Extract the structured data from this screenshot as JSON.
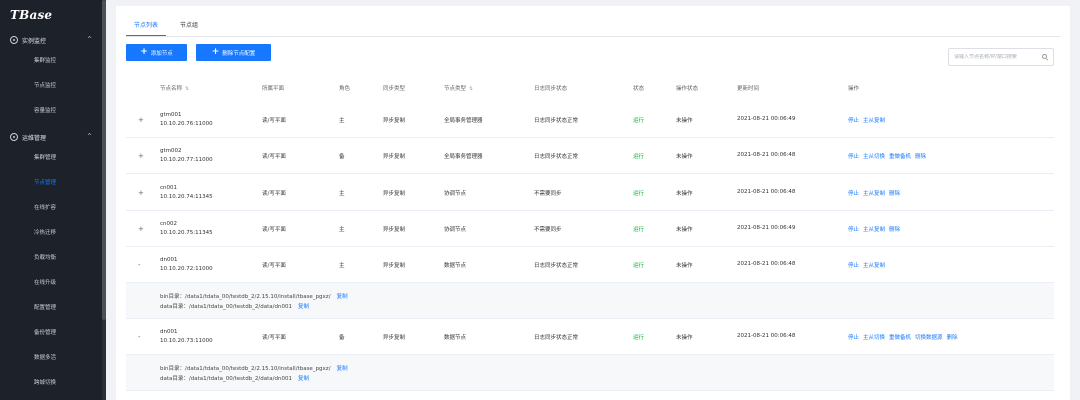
{
  "app": {
    "logo": "TBase"
  },
  "sidebar": {
    "groups": [
      {
        "label": "实例监控",
        "chevron": "^",
        "items": [
          "集群监控",
          "节点监控",
          "容量监控"
        ]
      },
      {
        "label": "运维管理",
        "chevron": "^",
        "items": [
          "集群管理",
          "节点管理",
          "在线扩容",
          "冷热迁移",
          "负载均衡",
          "在线升级",
          "配置管理",
          "备份管理",
          "数据多活",
          "跨城切换"
        ]
      }
    ],
    "active_item": "节点管理"
  },
  "tabs": [
    "节点列表",
    "节点组"
  ],
  "toolbar": {
    "add_node": "添加节点",
    "remove_config": "删除节点配置"
  },
  "search": {
    "placeholder": "请输入节点名称/IP/端口搜索"
  },
  "columns": [
    "节点名称",
    "所属平面",
    "角色",
    "同步类型",
    "节点类型",
    "日志同步状态",
    "状态",
    "操作状态",
    "更新时间",
    "操作"
  ],
  "rows": [
    {
      "expand": "+",
      "name": "gtm001",
      "addr": "10.10.20.76:11000",
      "plane": "读/写平面",
      "role": "主",
      "sync": "异步复制",
      "type": "全局事务管理器",
      "log": "日志同步状态正常",
      "status": "运行",
      "op": "未操作",
      "time": "2021-08-21 00:06:49",
      "actions": [
        "停止",
        "主从复制"
      ]
    },
    {
      "expand": "+",
      "name": "gtm002",
      "addr": "10.10.20.77:11000",
      "plane": "读/写平面",
      "role": "备",
      "sync": "异步复制",
      "type": "全局事务管理器",
      "log": "日志同步状态正常",
      "status": "运行",
      "op": "未操作",
      "time": "2021-08-21 00:06:48",
      "actions": [
        "停止",
        "主从切换",
        "重做备机",
        "删除"
      ]
    },
    {
      "expand": "+",
      "name": "cn001",
      "addr": "10.10.20.74:11345",
      "plane": "读/写平面",
      "role": "主",
      "sync": "异步复制",
      "type": "协调节点",
      "log": "不需要同步",
      "status": "运行",
      "op": "未操作",
      "time": "2021-08-21 00:06:48",
      "actions": [
        "停止",
        "主从复制",
        "删除"
      ]
    },
    {
      "expand": "+",
      "name": "cn002",
      "addr": "10.10.20.75:11345",
      "plane": "读/写平面",
      "role": "主",
      "sync": "异步复制",
      "type": "协调节点",
      "log": "不需要同步",
      "status": "运行",
      "op": "未操作",
      "time": "2021-08-21 00:06:49",
      "actions": [
        "停止",
        "主从复制",
        "删除"
      ]
    },
    {
      "expand": "-",
      "name": "dn001",
      "addr": "10.10.20.72:11000",
      "plane": "读/写平面",
      "role": "主",
      "sync": "异步复制",
      "type": "数据节点",
      "log": "日志同步状态正常",
      "status": "运行",
      "op": "未操作",
      "time": "2021-08-21 00:06:48",
      "actions": [
        "停止",
        "主从复制"
      ],
      "bin_dir": "bin目录：/data1/tdata_00/testdb_2/2.15.10/install/tbase_pgxz/",
      "data_dir": "data目录：/data1/tdata_00/testdb_2/data/dn001",
      "copy": "复制"
    },
    {
      "expand": "-",
      "name": "dn001",
      "addr": "10.10.20.73:11000",
      "plane": "读/写平面",
      "role": "备",
      "sync": "异步复制",
      "type": "数据节点",
      "log": "日志同步状态正常",
      "status": "运行",
      "op": "未操作",
      "time": "2021-08-21 00:06:48",
      "actions": [
        "停止",
        "主从切换",
        "重做备机",
        "切换数据源",
        "删除"
      ],
      "bin_dir": "bin目录：/data1/tdata_00/testdb_2/2.15.10/install/tbase_pgxz/",
      "data_dir": "data目录：/data1/tdata_00/testdb_2/data/dn001",
      "copy": "复制"
    }
  ]
}
